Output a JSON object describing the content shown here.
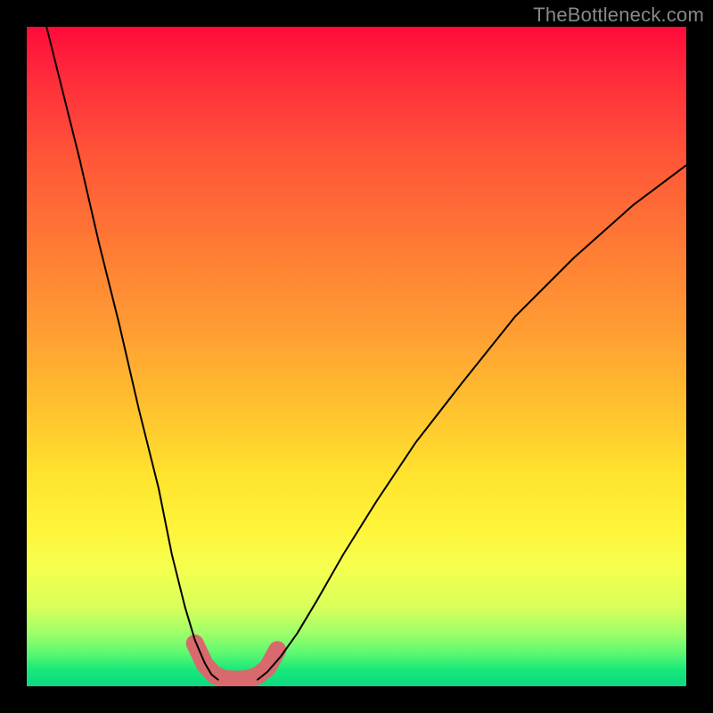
{
  "watermark": "TheBottleneck.com",
  "chart_data": {
    "type": "line",
    "title": "",
    "xlabel": "",
    "ylabel": "",
    "xlim": [
      0,
      100
    ],
    "ylim": [
      0,
      100
    ],
    "background_gradient": {
      "top_color": "#ff0b3a",
      "bottom_color": "#0bd982",
      "direction": "vertical"
    },
    "series": [
      {
        "name": "left-branch",
        "x": [
          3,
          5,
          8,
          11,
          14,
          17,
          20,
          22,
          24,
          25.5,
          27,
          28,
          29
        ],
        "values": [
          100,
          92,
          80,
          67,
          55,
          42,
          30,
          20,
          12,
          7,
          3.5,
          1.8,
          1
        ]
      },
      {
        "name": "right-branch",
        "x": [
          35,
          36.5,
          38.5,
          41,
          44,
          48,
          53,
          59,
          66,
          74,
          83,
          92,
          100
        ],
        "values": [
          1,
          2.2,
          4.5,
          8,
          13,
          20,
          28,
          37,
          46,
          56,
          65,
          73,
          79
        ]
      }
    ],
    "trough_highlight": {
      "color": "#d86a6d",
      "x": [
        25.5,
        27,
        28.5,
        30,
        32,
        33.5,
        35,
        36.5,
        38
      ],
      "values": [
        6.5,
        3.3,
        1.7,
        1.1,
        1,
        1.1,
        1.6,
        2.8,
        5.5
      ]
    }
  }
}
